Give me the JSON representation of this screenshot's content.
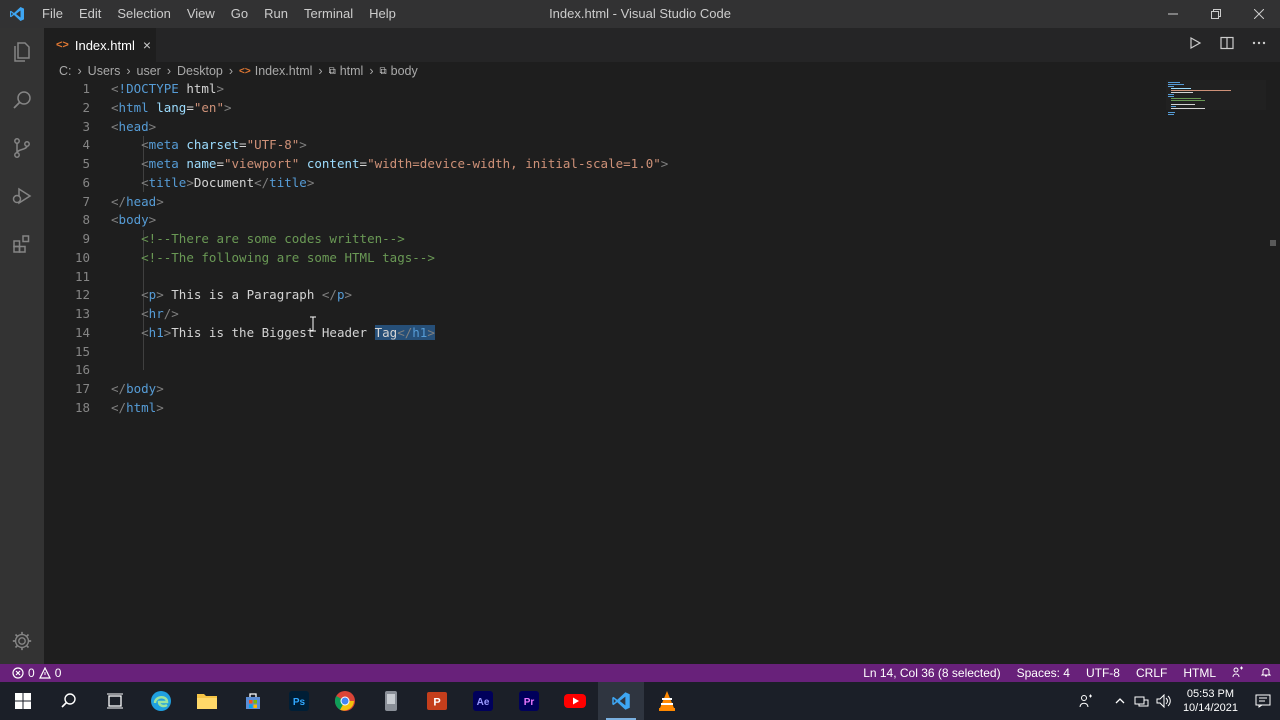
{
  "window": {
    "title": "Index.html - Visual Studio Code"
  },
  "menu": [
    "File",
    "Edit",
    "Selection",
    "View",
    "Go",
    "Run",
    "Terminal",
    "Help"
  ],
  "tab": {
    "label": "Index.html",
    "icon_text": "<>",
    "close": "×"
  },
  "breadcrumb": [
    "C:",
    "Users",
    "user",
    "Desktop",
    "Index.html",
    "html",
    "body"
  ],
  "editor": {
    "line_numbers": [
      "1",
      "2",
      "3",
      "4",
      "5",
      "6",
      "7",
      "8",
      "9",
      "10",
      "11",
      "12",
      "13",
      "14",
      "15",
      "16",
      "17",
      "18"
    ],
    "lines": [
      "<!DOCTYPE html>",
      "<html lang=\"en\">",
      "<head>",
      "    <meta charset=\"UTF-8\">",
      "    <meta name=\"viewport\" content=\"width=device-width, initial-scale=1.0\">",
      "    <title>Document</title>",
      "</head>",
      "<body>",
      "    <!--There are some codes written-->",
      "    <!--The following are some HTML tags-->",
      "",
      "    <p> This is a Paragraph </p>",
      "    <hr/>",
      "    <h1>This is the Biggest Header Tag</h1>",
      "",
      "",
      "</body>",
      "</html>"
    ],
    "selected_text": "Tag</h1>"
  },
  "statusbar": {
    "errors": "0",
    "warnings": "0",
    "position": "Ln 14, Col 36 (8 selected)",
    "spaces": "Spaces: 4",
    "encoding": "UTF-8",
    "eol": "CRLF",
    "language": "HTML"
  },
  "taskbar": {
    "apps": [
      "start-icon",
      "search-icon",
      "task-view-icon",
      "edge-icon",
      "file-explorer-icon",
      "store-icon",
      "photoshop-icon",
      "chrome-icon",
      "app-icon",
      "powerpoint-icon",
      "after-effects-icon",
      "premiere-icon",
      "youtube-icon",
      "vscode-icon",
      "vlc-icon"
    ],
    "app_labels": {
      "ps": "Ps",
      "pp": "P",
      "ae": "Ae",
      "pr": "Pr"
    },
    "time": "05:53 PM",
    "date": "10/14/2021"
  },
  "colors": {
    "statusbar": "#68217a",
    "titlebar": "#323233",
    "activitybar": "#333333",
    "editor_bg": "#1e1e1e",
    "selection": "#264f78"
  }
}
